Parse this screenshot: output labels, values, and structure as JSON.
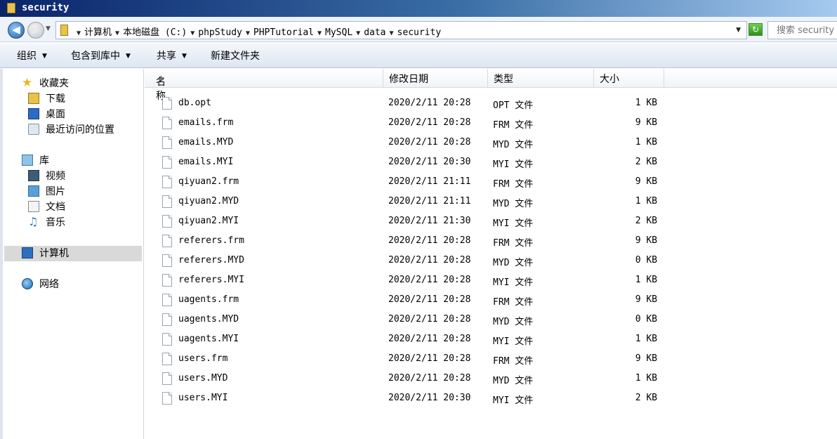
{
  "window": {
    "title": "security"
  },
  "address": {
    "crumbs": [
      "计算机",
      "本地磁盘 (C:)",
      "phpStudy",
      "PHPTutorial",
      "MySQL",
      "data",
      "security"
    ],
    "search_placeholder": "搜索 security"
  },
  "toolbar": {
    "organize": "组织",
    "include_in_library": "包含到库中",
    "share": "共享",
    "new_folder": "新建文件夹"
  },
  "sidebar": {
    "favorites": "收藏夹",
    "downloads": "下载",
    "desktop": "桌面",
    "recent": "最近访问的位置",
    "libraries": "库",
    "videos": "视频",
    "pictures": "图片",
    "documents": "文档",
    "music": "音乐",
    "computer": "计算机",
    "network": "网络"
  },
  "columns": {
    "name": "名称",
    "date": "修改日期",
    "type": "类型",
    "size": "大小"
  },
  "files": [
    {
      "name": "db.opt",
      "date": "2020/2/11 20:28",
      "type": "OPT 文件",
      "size": "1 KB"
    },
    {
      "name": "emails.frm",
      "date": "2020/2/11 20:28",
      "type": "FRM 文件",
      "size": "9 KB"
    },
    {
      "name": "emails.MYD",
      "date": "2020/2/11 20:28",
      "type": "MYD 文件",
      "size": "1 KB"
    },
    {
      "name": "emails.MYI",
      "date": "2020/2/11 20:30",
      "type": "MYI 文件",
      "size": "2 KB"
    },
    {
      "name": "qiyuan2.frm",
      "date": "2020/2/11 21:11",
      "type": "FRM 文件",
      "size": "9 KB"
    },
    {
      "name": "qiyuan2.MYD",
      "date": "2020/2/11 21:11",
      "type": "MYD 文件",
      "size": "1 KB"
    },
    {
      "name": "qiyuan2.MYI",
      "date": "2020/2/11 21:30",
      "type": "MYI 文件",
      "size": "2 KB"
    },
    {
      "name": "referers.frm",
      "date": "2020/2/11 20:28",
      "type": "FRM 文件",
      "size": "9 KB"
    },
    {
      "name": "referers.MYD",
      "date": "2020/2/11 20:28",
      "type": "MYD 文件",
      "size": "0 KB"
    },
    {
      "name": "referers.MYI",
      "date": "2020/2/11 20:28",
      "type": "MYI 文件",
      "size": "1 KB"
    },
    {
      "name": "uagents.frm",
      "date": "2020/2/11 20:28",
      "type": "FRM 文件",
      "size": "9 KB"
    },
    {
      "name": "uagents.MYD",
      "date": "2020/2/11 20:28",
      "type": "MYD 文件",
      "size": "0 KB"
    },
    {
      "name": "uagents.MYI",
      "date": "2020/2/11 20:28",
      "type": "MYI 文件",
      "size": "1 KB"
    },
    {
      "name": "users.frm",
      "date": "2020/2/11 20:28",
      "type": "FRM 文件",
      "size": "9 KB"
    },
    {
      "name": "users.MYD",
      "date": "2020/2/11 20:28",
      "type": "MYD 文件",
      "size": "1 KB"
    },
    {
      "name": "users.MYI",
      "date": "2020/2/11 20:30",
      "type": "MYI 文件",
      "size": "2 KB"
    }
  ]
}
